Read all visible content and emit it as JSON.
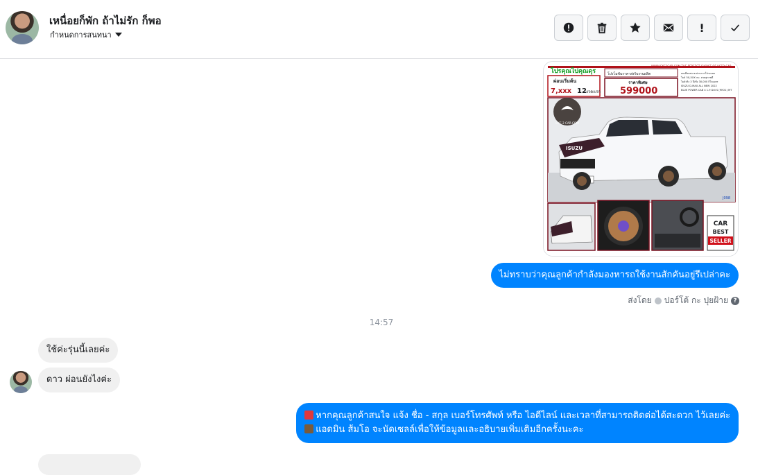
{
  "header": {
    "contact_name": "เหนื่อยก็พัก ถ้าไม่รัก ก็พอ",
    "assign_label": "กำหนดการสนทนา",
    "toolbar": [
      {
        "name": "report-icon"
      },
      {
        "name": "trash-icon"
      },
      {
        "name": "star-icon"
      },
      {
        "name": "mail-icon"
      },
      {
        "name": "exclamation-icon",
        "glyph": "!"
      },
      {
        "name": "check-icon"
      }
    ]
  },
  "car_ad": {
    "headline": "โปรคุณไปคุณดุร",
    "site": "WWW.CKC2CAR.COM THE PERFECT CHOICE OF USED CAR",
    "down_label": "ผ่อนเริ่มต้น",
    "monthly": "7,xxx",
    "installments": "12",
    "installments_label": "งวดแรก",
    "price_label": "ราคาพิเศษ",
    "price": "599000",
    "promo_line": "โปรโมชันราคาส่งรับงานผลิต",
    "spec_lines": [
      "ลดเลือกสบาย ผ่านการโปรเฉลย",
      "ไมล์ 5X,XXX กม. สวยสุภาพดี",
      "ไมล์จริง 3 ปี/ชั่ง 30,000 กิโลเมตร",
      "ISUZU D-MAX ALL NEW 2022",
      "BLUE POWER CAB 4 1.9 Ddi S (MY21) MT"
    ],
    "brand": "ISUZU",
    "logo_text": "CKC 2 CAR.COM",
    "badge": [
      "CAR",
      "BEST",
      "SELLER"
    ],
    "code": "J098"
  },
  "messages": {
    "out_1": "ไม่ทราบว่าคุณลูกค้ากำลังมองหารถใช้งานสักคันอยู่รึเปล่าคะ",
    "sent_by_label": "ส่งโดย",
    "sent_by_name": "ปอร์โต้ กะ ปุยฝ้าย",
    "timestamp": "14:57",
    "in_1": "ใช้ค่ะรุ่นนี้เลยค่ะ",
    "in_2": "ดาว ผ่อนยังไงค่ะ",
    "out_2_line1": "หากคุณลูกค้าสนใจ แจ้ง ชื่อ - สกุล เบอร์โทรศัพท์ หรือ ไอดีไลน์ และเวลาที่สามารถติดต่อได้สะดวก ไว้เลยค่ะ",
    "out_2_line2": "แอดมิน ส้มโอ จะนัดเซลล์เพื่อให้ข้อมูลและอธิบายเพิ่มเติมอีกครั้งนะคะ"
  },
  "colors": {
    "outgoing": "#0084ff",
    "incoming": "#f0f0f0",
    "ad_green": "#0c9a1c",
    "ad_red": "#b0121a",
    "ad_maroon": "#7a1020"
  }
}
